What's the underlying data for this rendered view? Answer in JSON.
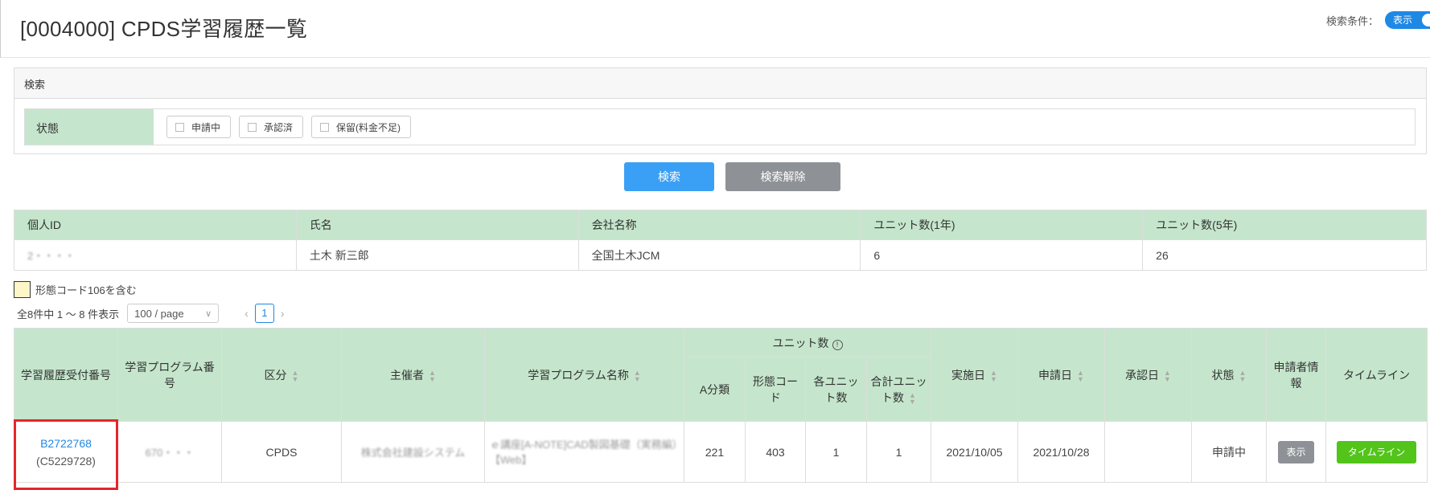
{
  "page": {
    "title": "[0004000] CPDS学習履歴一覧",
    "search_toggle_label": "検索条件：",
    "search_toggle_value": "表示"
  },
  "search": {
    "panel_title": "検索",
    "status_label": "状態",
    "checkboxes": [
      "申請中",
      "承認済",
      "保留(料金不足)"
    ],
    "search_button": "検索",
    "clear_button": "検索解除"
  },
  "person": {
    "headers": [
      "個人ID",
      "氏名",
      "会社名称",
      "ユニット数(1年)",
      "ユニット数(5年)"
    ],
    "values": [
      "2・・・・",
      "土木 新三郎",
      "全国土木JCM",
      "6",
      "26"
    ]
  },
  "legend": {
    "text": "形態コード106を含む",
    "swatch_color": "#fdf6c9"
  },
  "pager": {
    "summary": "全8件中 1 ～ 8 件表示",
    "page_size": "100 / page",
    "current_page": "1",
    "prev": "‹",
    "next": "›"
  },
  "table": {
    "headers": {
      "receipt_no": "学習履歴受付番号",
      "program_no": "学習プログラム番号",
      "category": "区分",
      "organizer": "主催者",
      "program_name": "学習プログラム名称",
      "units_group": "ユニット数",
      "a_class": "A分類",
      "form_code": "形態コード",
      "each_units": "各ユニット数",
      "total_units": "合計ユニット数",
      "date_held": "実施日",
      "date_applied": "申請日",
      "date_approved": "承認日",
      "status": "状態",
      "applicant_info": "申請者情報",
      "timeline": "タイムライン"
    },
    "rows": [
      {
        "receipt_no": "B2722768",
        "receipt_sub": "(C5229728)",
        "program_no": "670・・・",
        "category": "CPDS",
        "organizer": "株式会社建設システム",
        "program_name": "ｅ講座[A-NOTE]CAD製図基礎（実務編）【Web】",
        "a_class": "221",
        "form_code": "403",
        "each_units": "1",
        "total_units": "1",
        "date_held": "2021/10/05",
        "date_applied": "2021/10/28",
        "date_approved": "",
        "status": "申請中",
        "show_button": "表示",
        "timeline_button": "タイムライン"
      }
    ]
  },
  "colors": {
    "header_green": "#c5e6cc",
    "primary_blue": "#3aa0f5",
    "gray_button": "#8e9196",
    "timeline_green": "#52c41a",
    "highlight_red": "#e5262b"
  }
}
